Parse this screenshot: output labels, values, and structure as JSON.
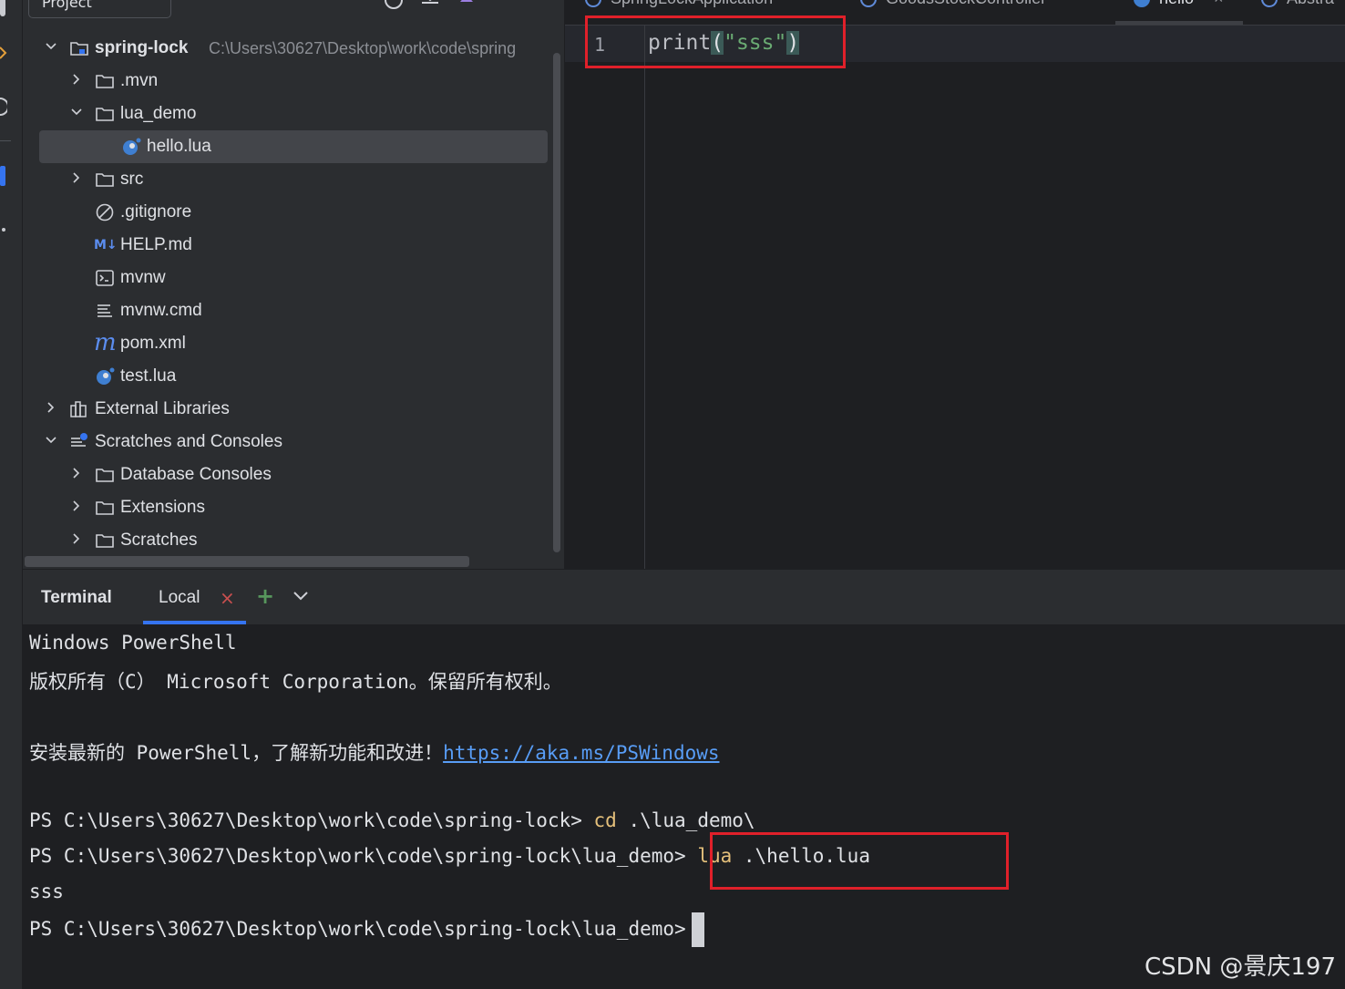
{
  "project_panel": {
    "dropdown_label": "Project",
    "root": {
      "label": "spring-lock",
      "path": "C:\\Users\\30627\\Desktop\\work\\code\\spring"
    },
    "items": [
      {
        "label": ".mvn"
      },
      {
        "label": "lua_demo"
      },
      {
        "label": "hello.lua"
      },
      {
        "label": "src"
      },
      {
        "label": ".gitignore"
      },
      {
        "label": "HELP.md",
        "badge": "M↓"
      },
      {
        "label": "mvnw"
      },
      {
        "label": "mvnw.cmd"
      },
      {
        "label": "pom.xml"
      },
      {
        "label": "test.lua"
      },
      {
        "label": "External Libraries"
      },
      {
        "label": "Scratches and Consoles"
      },
      {
        "label": "Database Consoles"
      },
      {
        "label": "Extensions"
      },
      {
        "label": "Scratches"
      }
    ]
  },
  "editor": {
    "tabs": [
      {
        "label": "SpringLockApplication"
      },
      {
        "label": "GoodsStockController"
      },
      {
        "label": "hello"
      },
      {
        "label": "Abstra"
      }
    ],
    "active_tab": "hello",
    "line_number": "1",
    "code": {
      "fn": "print",
      "open": "(",
      "string": "\"sss\"",
      "close": ")"
    }
  },
  "terminal": {
    "title": "Terminal",
    "tab_label": "Local",
    "lines": {
      "l1": "Windows PowerShell",
      "l2": "版权所有（C） Microsoft Corporation。保留所有权利。",
      "l3_text": "安装最新的 PowerShell，了解新功能和改进！",
      "l3_link": "https://aka.ms/PSWindows",
      "l4_prompt": "PS C:\\Users\\30627\\Desktop\\work\\code\\spring-lock> ",
      "l4_cmd": "cd",
      "l4_args": " .\\lua_demo\\",
      "l5_prompt": "PS C:\\Users\\30627\\Desktop\\work\\code\\spring-lock\\lua_demo> ",
      "l5_cmd": "lua",
      "l5_args": " .\\hello.lua",
      "l6": "sss",
      "l7_prompt": "PS C:\\Users\\30627\\Desktop\\work\\code\\spring-lock\\lua_demo>"
    }
  },
  "watermark": "CSDN @景庆197",
  "colors": {
    "accent": "#3574f0",
    "highlight_box": "#e0202a",
    "string": "#6aab73",
    "command": "#e5c07b",
    "link": "#589df6"
  }
}
